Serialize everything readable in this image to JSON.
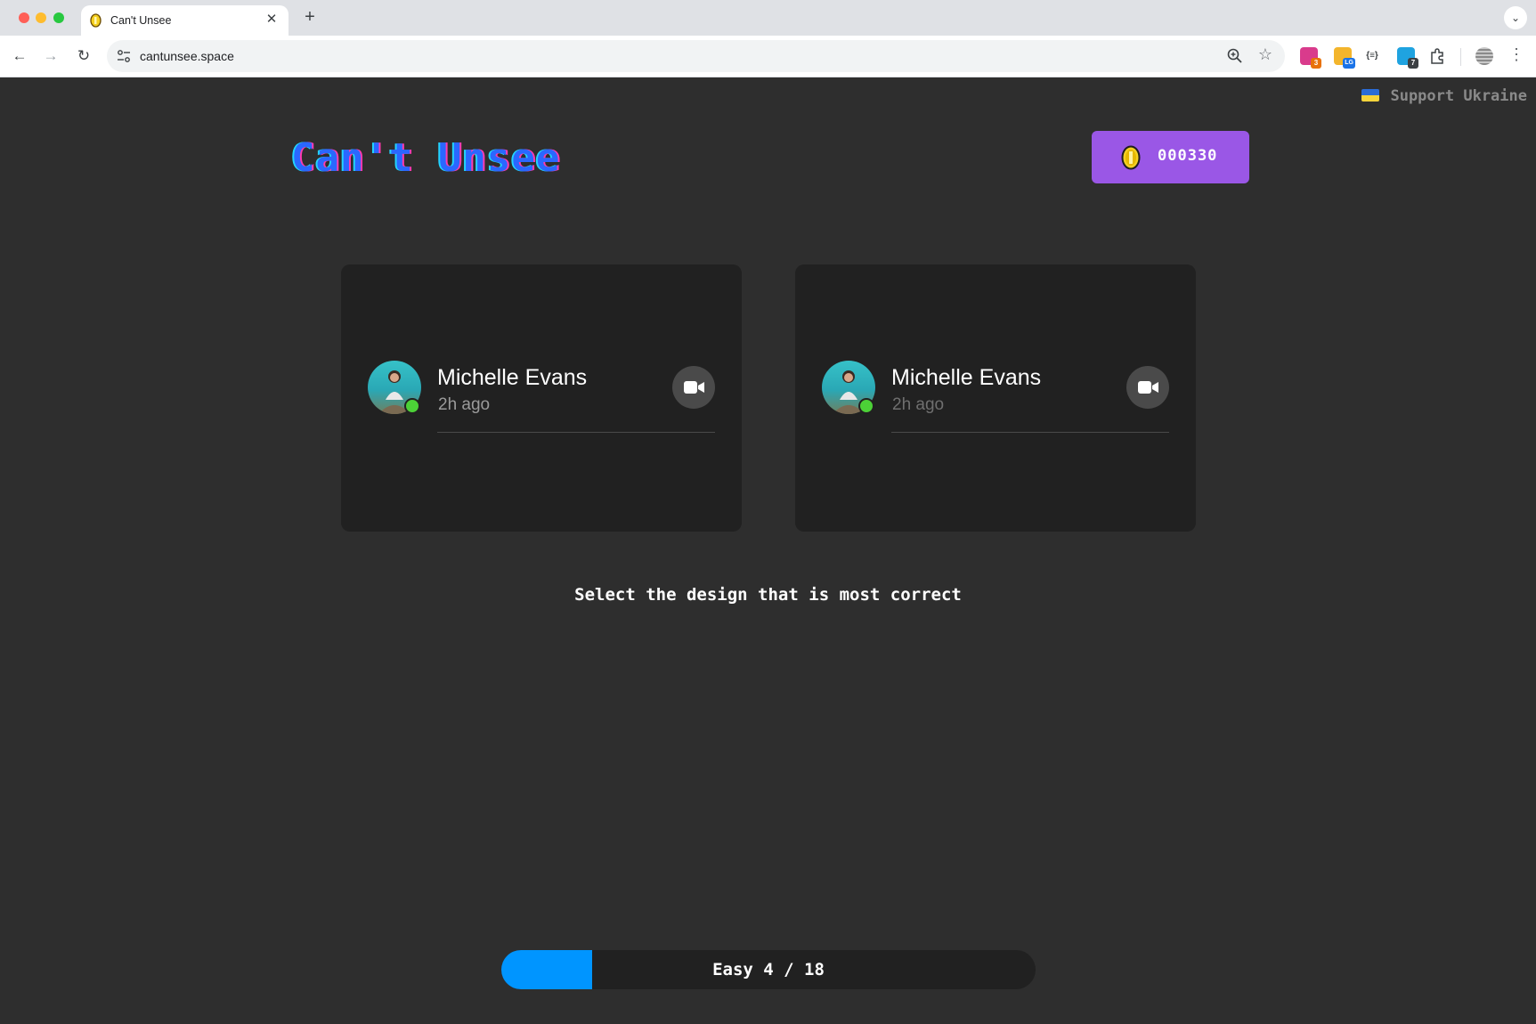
{
  "browser": {
    "tab_title": "Can't Unsee",
    "new_tab": "+",
    "tab_close": "✕",
    "url": "cantunsee.space",
    "extensions": [
      {
        "name": "extension-1",
        "badge": "3",
        "color": "#d93b8c",
        "badge_color": "#e8710a"
      },
      {
        "name": "extension-2",
        "badge": "LG",
        "color": "#f3b52c",
        "badge_color": "#1a73e8"
      },
      {
        "name": "extension-3",
        "badge": "",
        "color": "#ffffff",
        "badge_color": ""
      },
      {
        "name": "extension-4",
        "badge": "7",
        "color": "#1fa3e0",
        "badge_color": "#3c4043"
      }
    ]
  },
  "header": {
    "support_text": "Support Ukraine",
    "logo": "Can't Unsee",
    "coin_count": "000330"
  },
  "cards": [
    {
      "id": "left",
      "name": "Michelle Evans",
      "time": "2h ago",
      "status": "online"
    },
    {
      "id": "right",
      "name": "Michelle Evans",
      "time": "2h ago",
      "status": "online"
    }
  ],
  "prompt": "Select the design that is most correct",
  "progress": {
    "label": "Easy 4 / 18",
    "level": "Easy",
    "current": 4,
    "total": 18,
    "fill_fraction": 0.17
  },
  "colors": {
    "page_bg": "#2e2e2e",
    "card_bg": "#212121",
    "coin_button": "#9a57e6",
    "progress_fill": "#0095ff",
    "status_online": "#4cd137"
  }
}
